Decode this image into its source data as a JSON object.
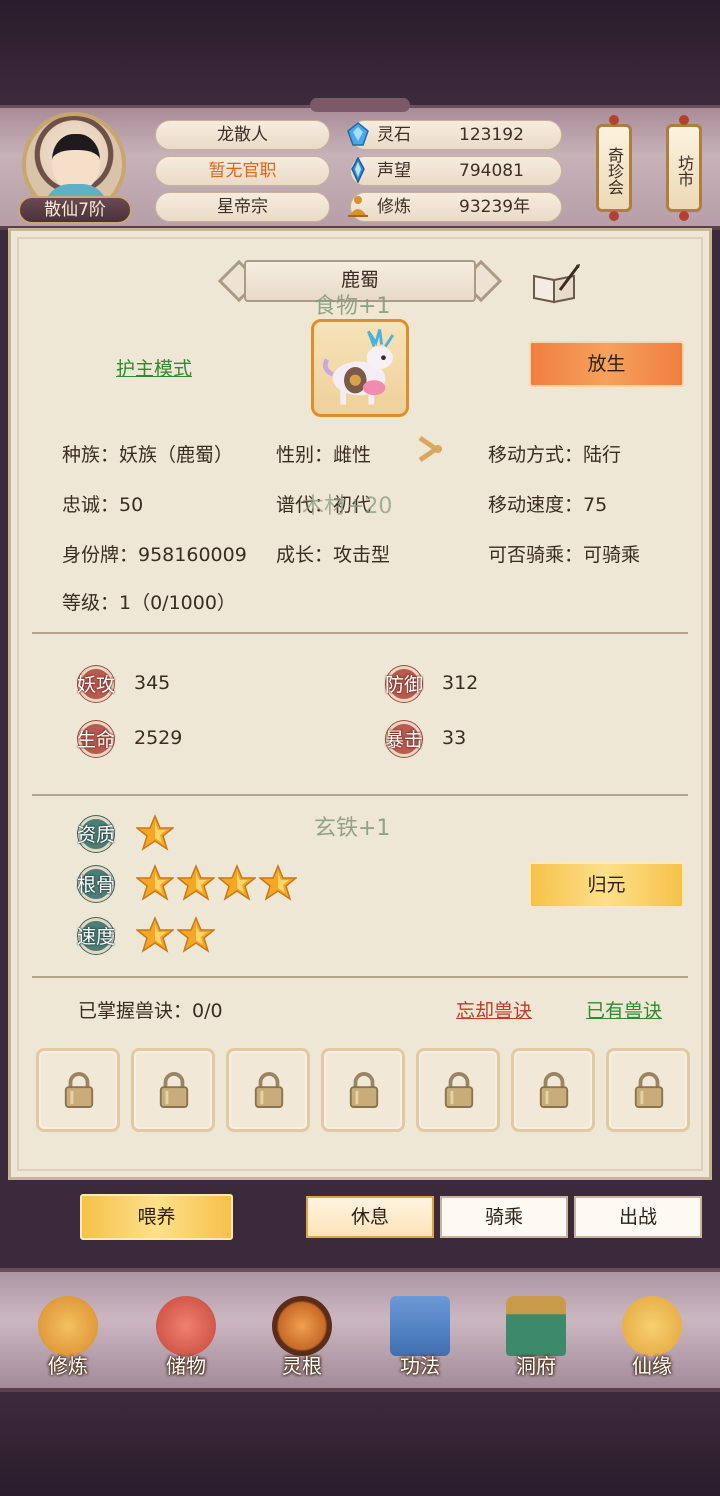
{
  "profile": {
    "name": "龙散人",
    "official_post": "暂无官职",
    "sect": "星帝宗",
    "rank": "散仙7阶"
  },
  "resources": [
    {
      "label": "灵石",
      "value": "123192",
      "icon": "spirit-stone-icon",
      "color": "#4aa8e8"
    },
    {
      "label": "声望",
      "value": "794081",
      "icon": "prestige-crystal-icon",
      "color": "#3c8fd6"
    },
    {
      "label": "修炼",
      "value": "93239年",
      "icon": "meditation-icon",
      "color": "#d9902f"
    }
  ],
  "shortcuts": {
    "treasure_fair": "奇珍会",
    "market": "坊市"
  },
  "pet": {
    "name": "鹿蜀",
    "mode_link": "护主模式",
    "release_button": "放生",
    "float_food": "食物+1",
    "float_wood": "木材+20",
    "float_iron": "玄铁+1",
    "info": {
      "race": "种族：妖族（鹿蜀）",
      "gender": "性别：雌性",
      "move_type": "移动方式：陆行",
      "loyalty": "忠诚：50",
      "generation": "谱代：初代",
      "move_speed": "移动速度：75",
      "id_tag": "身份牌：958160009",
      "growth": "成长：攻击型",
      "rideable": "可否骑乘：可骑乘",
      "level": "等级：1（0/1000）"
    }
  },
  "stats": [
    {
      "label": "妖攻",
      "value": "345"
    },
    {
      "label": "防御",
      "value": "312"
    },
    {
      "label": "生命",
      "value": "2529"
    },
    {
      "label": "暴击",
      "value": "33"
    }
  ],
  "aptitude": [
    {
      "label": "资质",
      "stars": 1
    },
    {
      "label": "根骨",
      "stars": 4
    },
    {
      "label": "速度",
      "stars": 2
    }
  ],
  "reset_button": "归元",
  "skills": {
    "mastered": "已掌握兽诀：0/0",
    "forget_link": "忘却兽诀",
    "owned_link": "已有兽诀",
    "slots_locked": 7
  },
  "actions": {
    "feed": "喂养",
    "rest": "休息",
    "ride": "骑乘",
    "battle": "出战"
  },
  "nav": [
    {
      "label": "修炼",
      "icon": "cultivate-icon",
      "color": "#d88a2c"
    },
    {
      "label": "储物",
      "icon": "storage-bag-icon",
      "color": "#c4473a"
    },
    {
      "label": "灵根",
      "icon": "spirit-root-icon",
      "color": "#c86a28"
    },
    {
      "label": "功法",
      "icon": "technique-book-icon",
      "color": "#3f6fb0"
    },
    {
      "label": "洞府",
      "icon": "cave-mansion-icon",
      "color": "#3c8a6a"
    },
    {
      "label": "仙缘",
      "icon": "destiny-gourd-icon",
      "color": "#e0a33a"
    }
  ]
}
